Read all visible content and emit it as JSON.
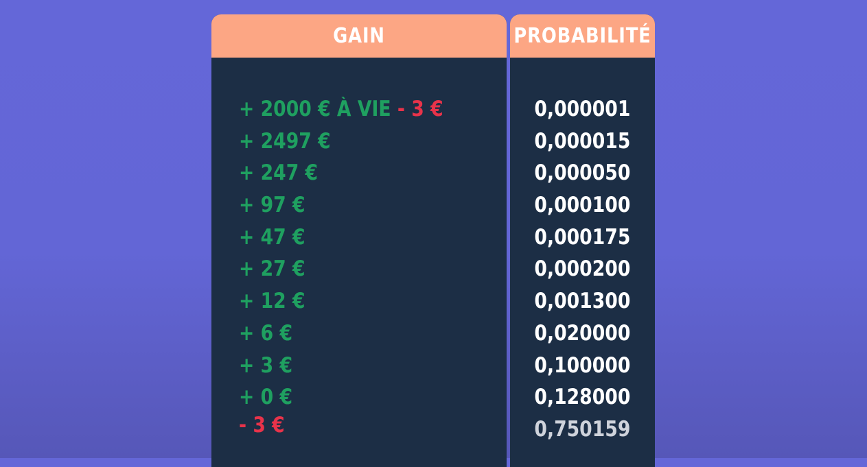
{
  "table": {
    "headers": {
      "gain": "GAIN",
      "probability": "PROBABILITÉ"
    },
    "rows": [
      {
        "gain": "+ 2000 € À VIE",
        "gain_extra": "- 3 €",
        "probability": "0,000001"
      },
      {
        "gain": "+ 2497 €",
        "probability": "0,000015"
      },
      {
        "gain": "+ 247 €",
        "probability": "0,000050"
      },
      {
        "gain": "+ 97 €",
        "probability": "0,000100"
      },
      {
        "gain": "+ 47 €",
        "probability": "0,000175"
      },
      {
        "gain": "+ 27 €",
        "probability": "0,000200"
      },
      {
        "gain": "+ 12 €",
        "probability": "0,001300"
      },
      {
        "gain": "+ 6 €",
        "probability": "0,020000"
      },
      {
        "gain": "+ 3 €",
        "probability": "0,100000"
      },
      {
        "gain": "+ 0 €",
        "probability": "0,128000"
      },
      {
        "gain_loss": "- 3 €",
        "probability": "0,750159"
      }
    ]
  },
  "colors": {
    "background": "#6467d8",
    "table_body": "#1c2e45",
    "header": "#fca684",
    "gain_positive": "#1fa060",
    "gain_negative": "#e8334a",
    "probability_text": "#ffffff"
  }
}
